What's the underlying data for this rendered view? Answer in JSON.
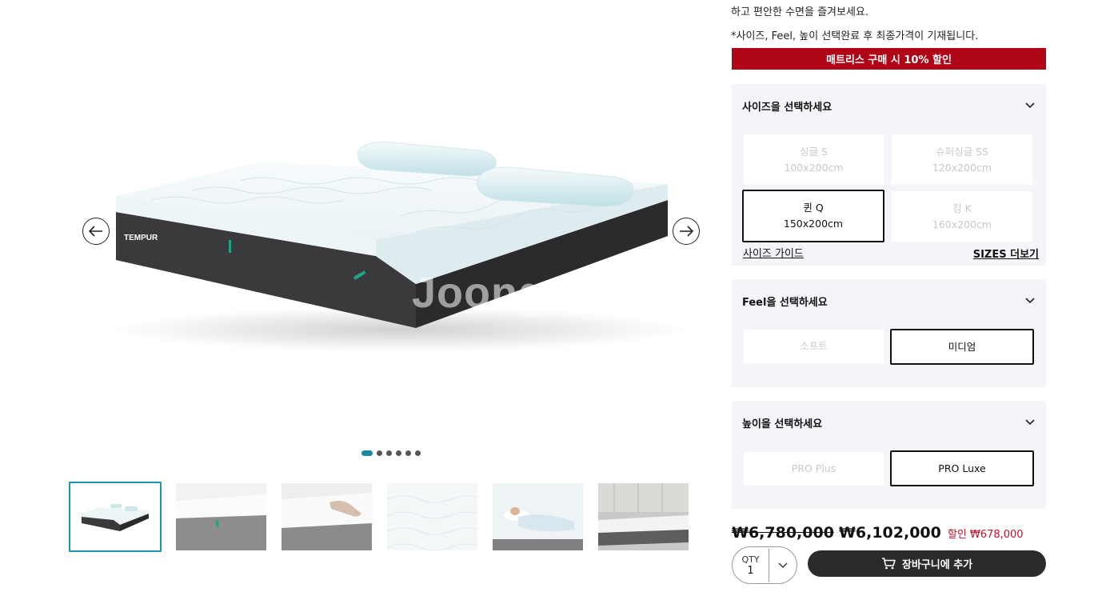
{
  "gallery": {
    "watermark": "Joongang",
    "brand_label": "TEMPUR",
    "dots_count": 6,
    "active_dot": 0,
    "thumbnails": [
      "mattress",
      "mattress-side",
      "mattress-hand",
      "fabric-closeup",
      "woman-sleeping",
      "bedroom"
    ],
    "active_thumbnail": 0
  },
  "product": {
    "intro_line": "하고 편안한 수면을 즐겨보세요.",
    "price_note": "*사이즈, Feel, 높이 선택완료 후 최종가격이 기재됩니다.",
    "promo_banner": "매트리스 구매 시 10% 할인"
  },
  "size_section": {
    "title": "사이즈을 선택하세요",
    "options": [
      {
        "name": "싱글 S",
        "dims": "100x200cm",
        "selected": false
      },
      {
        "name": "슈퍼싱글 SS",
        "dims": "120x200cm",
        "selected": false
      },
      {
        "name": "퀸 Q",
        "dims": "150x200cm",
        "selected": true
      },
      {
        "name": "킹 K",
        "dims": "160x200cm",
        "selected": false
      }
    ],
    "guide_link": "사이즈 가이드",
    "more_link": "SIZES 더보기"
  },
  "feel_section": {
    "title": "Feel을 선택하세요",
    "options": [
      {
        "name": "소프트",
        "selected": false
      },
      {
        "name": "미디엄",
        "selected": true
      }
    ]
  },
  "height_section": {
    "title": "높이을 선택하세요",
    "options": [
      {
        "name": "PRO Plus",
        "selected": false
      },
      {
        "name": "PRO Luxe",
        "selected": true
      }
    ]
  },
  "pricing": {
    "original": "₩6,780,000",
    "sale": "₩6,102,000",
    "discount": "할인 ₩678,000"
  },
  "purchase": {
    "qty_label": "QTY",
    "qty_value": "1",
    "cart_label": "장바구니에 추가"
  },
  "colors": {
    "promo_red": "#b00417",
    "accent_teal": "#1b8aa0",
    "button_dark": "#2b2b2b",
    "discount_red": "#c0122a"
  }
}
